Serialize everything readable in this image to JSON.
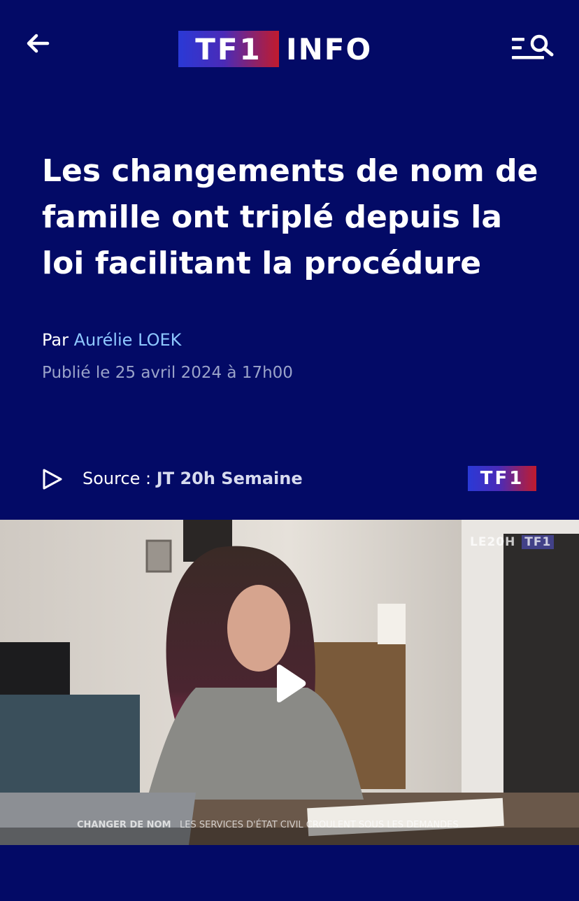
{
  "header": {
    "back_icon": "arrow-left-icon",
    "logo_tf1": "TF1",
    "logo_info": "INFO",
    "menu_icon": "menu-search-icon"
  },
  "article": {
    "headline": "Les changements de nom de famille ont triplé depuis la loi facilitant la procédure",
    "byline_prefix": "Par",
    "author": "Aurélie LOEK",
    "published": "Publié le 25 avril 2024 à 17h00"
  },
  "source": {
    "label": "Source :",
    "value": "JT 20h Semaine",
    "channel_badge": "TF1"
  },
  "video": {
    "watermark_show": "LE20H",
    "watermark_channel": "TF1",
    "caption_title": "CHANGER DE NOM",
    "caption_subtitle": "LES SERVICES D'ÉTAT CIVIL CROULENT SOUS LES DEMANDES",
    "play_icon": "play-icon"
  },
  "colors": {
    "background": "#030a66",
    "author_link": "#8ec8ff",
    "meta_text": "#9aa3c9"
  }
}
